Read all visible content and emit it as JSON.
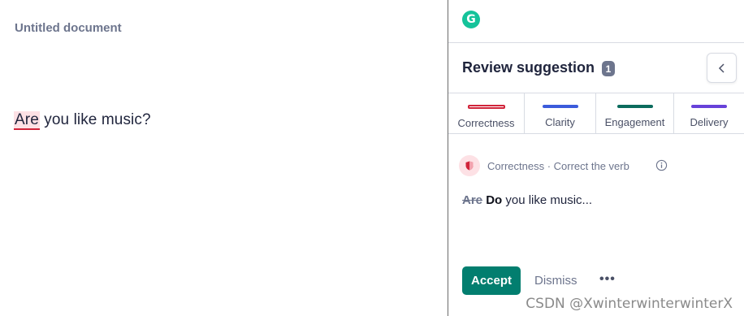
{
  "editor": {
    "title": "Untitled document",
    "flagged_word": "Are",
    "rest_text": " you like music?"
  },
  "panel": {
    "logo_letter": "G",
    "review_title": "Review suggestion",
    "review_count": "1",
    "tabs": [
      {
        "label": "Correctness",
        "color": "#d1243a"
      },
      {
        "label": "Clarity",
        "color": "#3b5bdb"
      },
      {
        "label": "Engagement",
        "color": "#0b6b5d"
      },
      {
        "label": "Delivery",
        "color": "#6741d9"
      }
    ],
    "card": {
      "category": "Correctness · Correct the verb",
      "old_word": "Are",
      "new_word": "Do",
      "rest": " you like music...",
      "accept_label": "Accept",
      "dismiss_label": "Dismiss",
      "more_label": "•••"
    }
  },
  "watermark": "CSDN @XwinterwinterwinterX"
}
